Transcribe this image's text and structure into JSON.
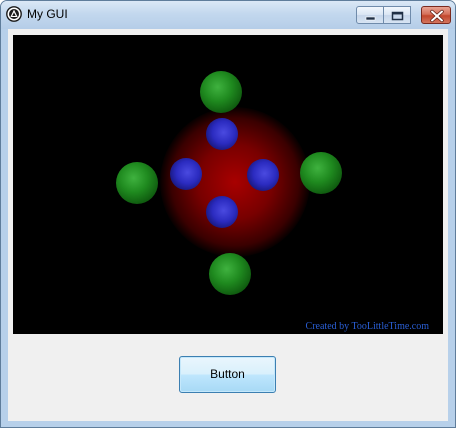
{
  "window": {
    "title": "My GUI",
    "app_icon": "autoit-icon",
    "controls": [
      "minimize-icon",
      "maximize-icon",
      "close-icon"
    ]
  },
  "canvas": {
    "credit_text": "Created by TooLittleTime.com",
    "background_color": "#000000",
    "glow_color": "#a80000",
    "green_ball_color": "#2a9a2a",
    "blue_ball_color": "#3535d0",
    "green_balls": 4,
    "blue_balls": 4
  },
  "button": {
    "label": "Button"
  }
}
